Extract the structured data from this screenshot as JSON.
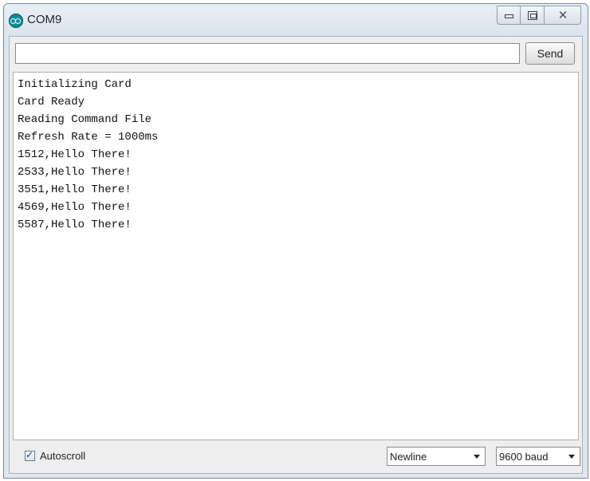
{
  "window": {
    "title": "COM9",
    "icon": "arduino-icon"
  },
  "caption_buttons": {
    "minimize_icon": "minimize-icon",
    "maximize_icon": "maximize-icon",
    "close_icon": "close-icon",
    "close_glyph": "✕"
  },
  "input": {
    "value": "",
    "placeholder": ""
  },
  "send_label": "Send",
  "console": {
    "lines": [
      "Initializing Card",
      "Card Ready",
      "Reading Command File",
      "Refresh Rate = 1000ms",
      "1512,Hello There!",
      "2533,Hello There!",
      "3551,Hello There!",
      "4569,Hello There!",
      "5587,Hello There!"
    ]
  },
  "footer": {
    "autoscroll_label": "Autoscroll",
    "autoscroll_checked": true,
    "line_ending": "Newline",
    "baud": "9600 baud"
  },
  "colors": {
    "icon_teal": "#0d8c99",
    "title_bar": "#dfe6ee"
  }
}
